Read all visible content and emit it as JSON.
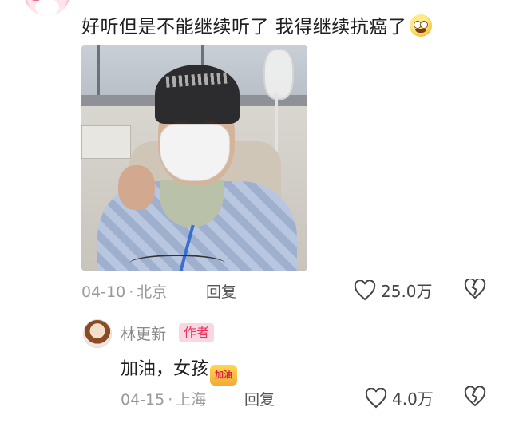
{
  "comment": {
    "text": "好听但是不能继续听了 我得继续抗癌了",
    "emoji": "grinning-face-emoji",
    "date": "04-10",
    "location": "北京",
    "reply_label": "回复",
    "likes": "25.0万"
  },
  "reply": {
    "username": "林更新",
    "badge": "作者",
    "text": "加油，女孩",
    "sticker_text": "加油",
    "date": "04-15",
    "location": "上海",
    "reply_label": "回复",
    "likes": "4.0万"
  },
  "colors": {
    "author_badge_bg": "#f8d7e0",
    "author_badge_text": "#e8335f",
    "meta_text": "#9a9a9a"
  }
}
